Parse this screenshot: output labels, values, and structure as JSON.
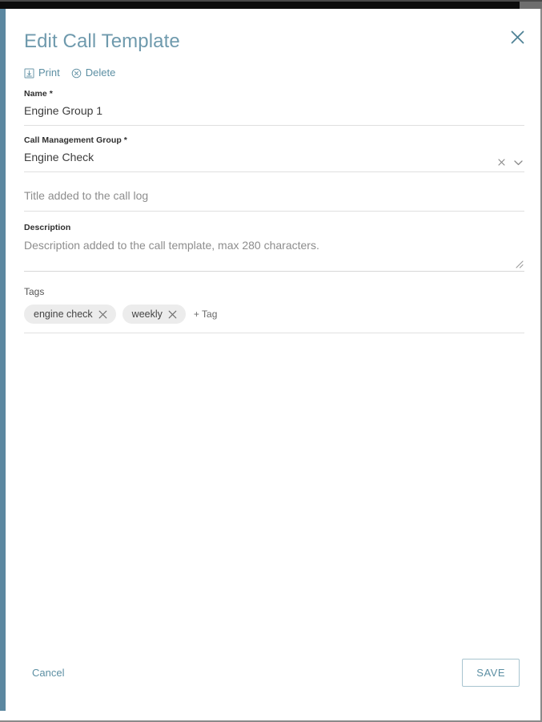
{
  "header": {
    "title": "Edit Call Template",
    "close_icon": "close-icon"
  },
  "actions": [
    {
      "label": "Print",
      "icon": "print-icon"
    },
    {
      "label": "Delete",
      "icon": "delete-circle-icon"
    }
  ],
  "form": {
    "name": {
      "label": "Name *",
      "value": "Engine Group 1"
    },
    "call_management_group": {
      "label": "Call Management Group *",
      "value": "Engine Check",
      "clear_icon": "clear-x-icon",
      "dropdown_icon": "chevron-down-icon"
    },
    "title": {
      "placeholder": "Title added to the call log",
      "value": ""
    },
    "description": {
      "label": "Description",
      "placeholder": "Description added to the call template, max 280 characters.",
      "value": "",
      "resize_icon": "resize-grip-icon"
    },
    "tags": {
      "label": "Tags",
      "chips": [
        {
          "label": "engine check",
          "remove_icon": "chip-remove-icon"
        },
        {
          "label": "weekly",
          "remove_icon": "chip-remove-icon"
        }
      ],
      "add_label": "+ Tag"
    }
  },
  "footer": {
    "cancel_label": "Cancel",
    "save_label": "SAVE"
  },
  "colors": {
    "accent_teal": "#5c8fa3",
    "title_teal": "#6f9aad",
    "left_strip": "#5b87a0",
    "chip_bg": "#ececec",
    "field_underline": "#e0e0e0"
  }
}
